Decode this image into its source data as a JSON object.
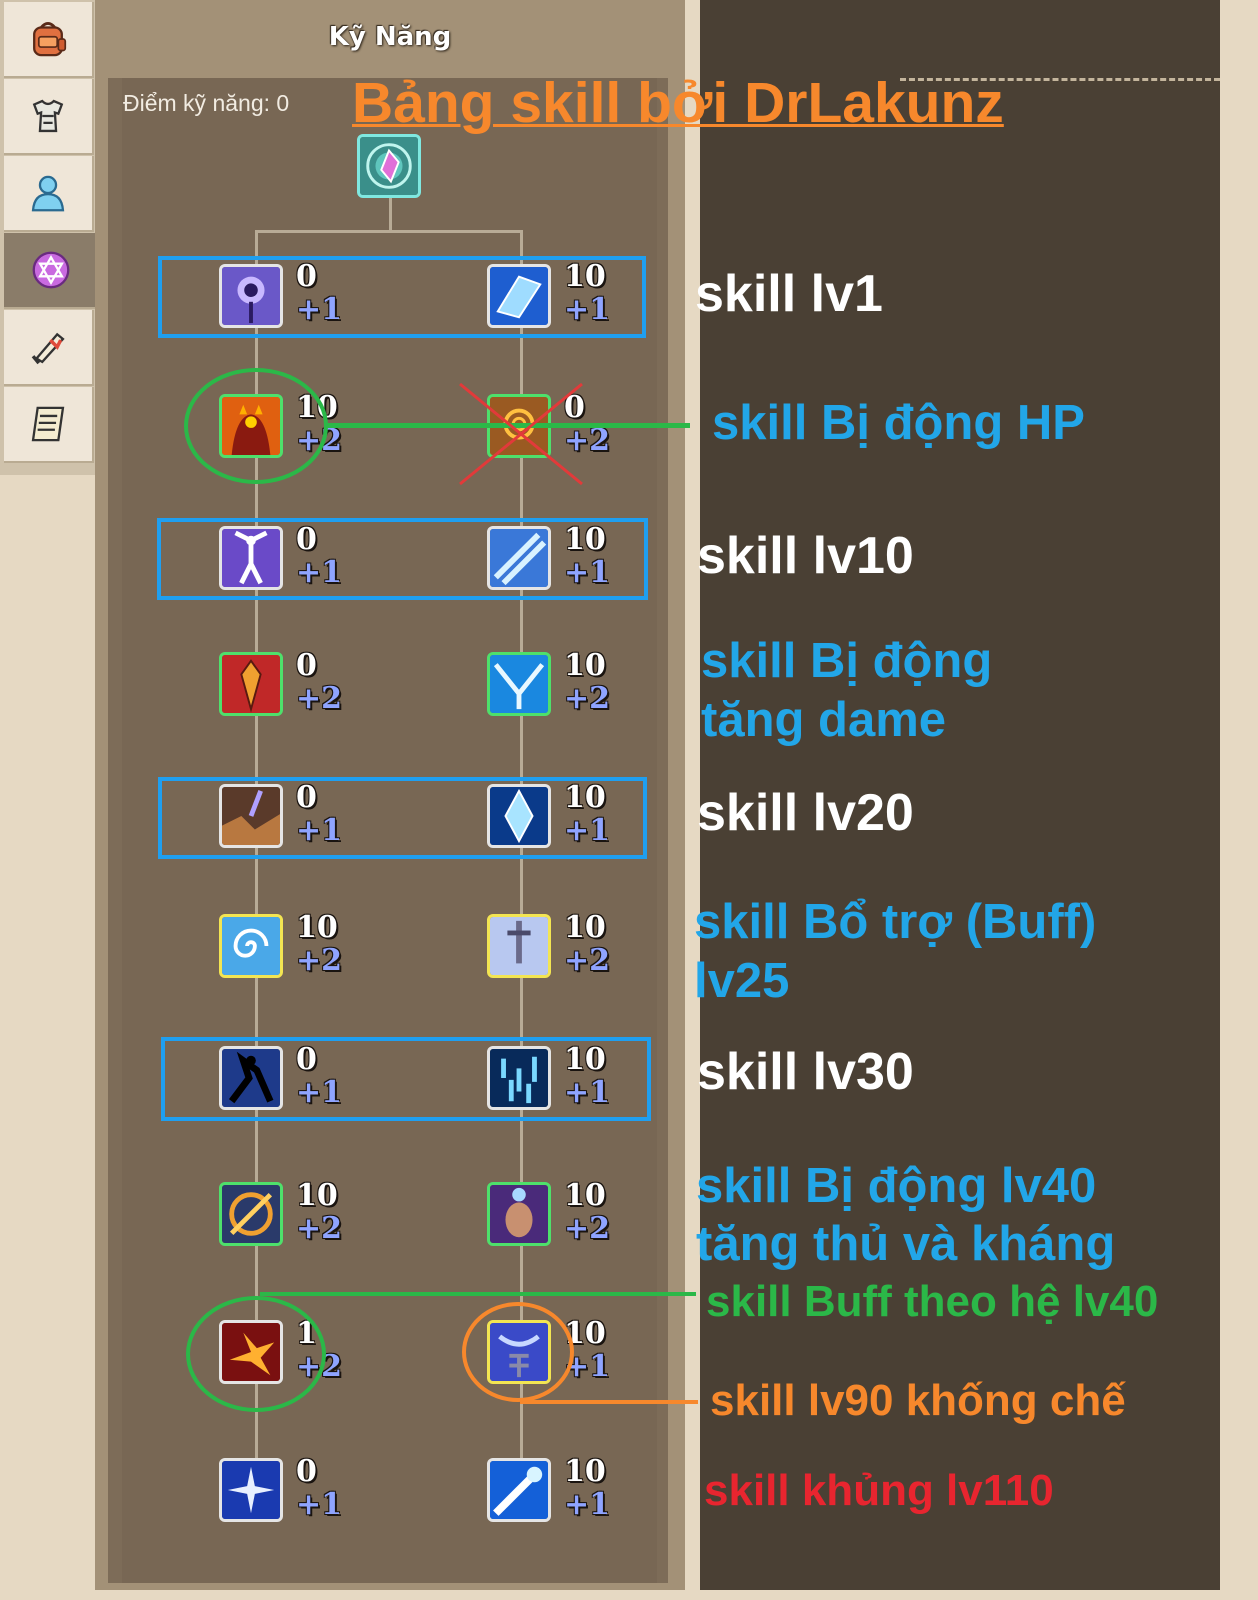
{
  "window": {
    "title": "Kỹ Năng"
  },
  "skill_points": {
    "label": "Điểm kỹ năng: 0"
  },
  "annotation_title": "Bảng skill bởi DrLakunz",
  "tabs": [
    {
      "icon": "backpack-icon"
    },
    {
      "icon": "armor-icon"
    },
    {
      "icon": "character-icon"
    },
    {
      "icon": "hexagram-icon"
    },
    {
      "icon": "scroll-icon"
    },
    {
      "icon": "quest-list-icon"
    }
  ],
  "rows": [
    {
      "left": {
        "level": "0",
        "plus": "+1"
      },
      "right": {
        "level": "10",
        "plus": "+1"
      }
    },
    {
      "left": {
        "level": "10",
        "plus": "+2"
      },
      "right": {
        "level": "0",
        "plus": "+2"
      }
    },
    {
      "left": {
        "level": "0",
        "plus": "+1"
      },
      "right": {
        "level": "10",
        "plus": "+1"
      }
    },
    {
      "left": {
        "level": "0",
        "plus": "+2"
      },
      "right": {
        "level": "10",
        "plus": "+2"
      }
    },
    {
      "left": {
        "level": "0",
        "plus": "+1"
      },
      "right": {
        "level": "10",
        "plus": "+1"
      }
    },
    {
      "left": {
        "level": "10",
        "plus": "+2"
      },
      "right": {
        "level": "10",
        "plus": "+2"
      }
    },
    {
      "left": {
        "level": "0",
        "plus": "+1"
      },
      "right": {
        "level": "10",
        "plus": "+1"
      }
    },
    {
      "left": {
        "level": "10",
        "plus": "+2"
      },
      "right": {
        "level": "10",
        "plus": "+2"
      }
    },
    {
      "left": {
        "level": "1",
        "plus": "+2"
      },
      "right": {
        "level": "10",
        "plus": "+1"
      }
    },
    {
      "left": {
        "level": "0",
        "plus": "+1"
      },
      "right": {
        "level": "10",
        "plus": "+1"
      }
    }
  ],
  "notes": {
    "lv1": "skill lv1",
    "passive_hp": "skill Bị động HP",
    "lv10": "skill lv10",
    "passive_dmg_1": "skill Bị động",
    "passive_dmg_2": "tăng dame",
    "lv20": "skill lv20",
    "buff_1": "skill Bổ trợ (Buff)",
    "buff_2": "lv25",
    "lv30": "skill lv30",
    "passive_def_1": "skill Bị động lv40",
    "passive_def_2": "tăng thủ và kháng",
    "buff_element": "skill Buff theo hệ lv40",
    "lv90": "skill lv90 khống chế",
    "lv110": "skill khủng lv110"
  },
  "colors": {
    "highlight_box": "#1f9ff0",
    "annotation_blue": "#22a6e8",
    "annotation_green": "#2bb848",
    "annotation_orange": "#f7882c",
    "annotation_red": "#e8252f",
    "cross_red": "#e23a3a"
  }
}
